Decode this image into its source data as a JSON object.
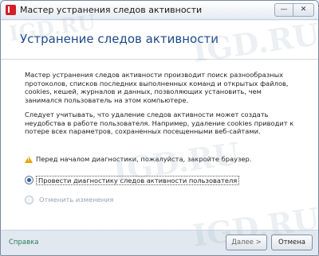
{
  "window": {
    "title": "Мастер устранения следов активности",
    "minimize_glyph": "—",
    "close_glyph": "✕"
  },
  "header": {
    "heading": "Устранение следов активности"
  },
  "content": {
    "paragraph_1": "Мастер устранения следов активности производит поиск разнообразных протоколов, списков последних выполненных команд и открытых файлов, cookies, кешей, журналов и данных, позволяющих установить, чем занимался пользователь на этом компьютере.",
    "paragraph_2": "Следует учитывать, что удаление следов активности может создать неудобства в работе пользователя. Например, удаление cookies приводит к потере всех параметров, сохраненных посещенными веб-сайтами.",
    "warning": "Перед началом диагностики, пожалуйста, закройте браузер.",
    "options": [
      {
        "label": "Провести диагностику следов активности пользователя",
        "selected": true,
        "enabled": true
      },
      {
        "label": "Отменить изменения",
        "selected": false,
        "enabled": false
      }
    ]
  },
  "footer": {
    "help_label": "Справка",
    "next_label": "Далее >",
    "cancel_label": "Отмена"
  },
  "watermark": {
    "text": "IGD.RU"
  },
  "colors": {
    "heading": "#1c4a8c",
    "help_link": "#2b7a5a",
    "warning_icon": "#e8a400",
    "app_icon": "#d31f26"
  }
}
